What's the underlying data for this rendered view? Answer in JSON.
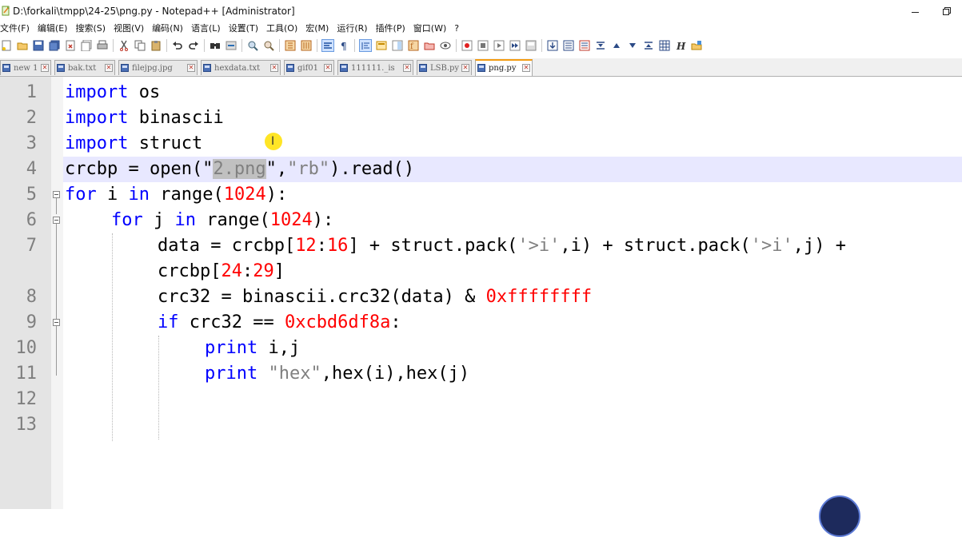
{
  "window": {
    "title": "D:\\forkali\\tmpp\\24-25\\png.py - Notepad++ [Administrator]"
  },
  "menu": [
    "文件(F)",
    "编辑(E)",
    "搜索(S)",
    "视图(V)",
    "编码(N)",
    "语言(L)",
    "设置(T)",
    "工具(O)",
    "宏(M)",
    "运行(R)",
    "插件(P)",
    "窗口(W)",
    "?"
  ],
  "toolbar_icons": [
    "new-file-icon",
    "open-file-icon",
    "save-icon",
    "save-all-icon",
    "close-icon",
    "close-all-icon",
    "print-icon",
    "cut-icon",
    "copy-icon",
    "paste-icon",
    "undo-icon",
    "redo-icon",
    "find-icon",
    "replace-icon",
    "zoom-in-icon",
    "zoom-out-icon",
    "sync-vertical-icon",
    "sync-horizontal-icon",
    "word-wrap-icon",
    "show-all-chars-icon",
    "indent-guide-icon",
    "user-language-icon",
    "doc-map-icon",
    "function-list-icon",
    "folder-workspace-icon",
    "monitoring-icon",
    "record-macro-icon",
    "stop-record-icon",
    "play-macro-icon",
    "play-multiple-icon",
    "save-macro-icon",
    "compare-icon",
    "compare-lines-icon",
    "compare-diff-icon",
    "navigate-first-icon",
    "navigate-prev-icon",
    "navigate-next-icon",
    "navigate-last-icon",
    "settings-grid-icon",
    "hex-h-icon",
    "plugin-folder-icon"
  ],
  "tabs": [
    {
      "label": "new 1",
      "active": false
    },
    {
      "label": "bak.txt",
      "active": false
    },
    {
      "label": "filejpg.jpg",
      "active": false
    },
    {
      "label": "hexdata.txt",
      "active": false
    },
    {
      "label": "gif01",
      "active": false
    },
    {
      "label": "111111._is",
      "active": false
    },
    {
      "label": "LSB.py",
      "active": false
    },
    {
      "label": "png.py",
      "active": true
    }
  ],
  "editor": {
    "line_numbers": [
      "1",
      "2",
      "3",
      "4",
      "5",
      "6",
      "7",
      "",
      "8",
      "9",
      "10",
      "11",
      "12",
      "13"
    ],
    "code": {
      "l1_kw": "import",
      "l1_rest": " os",
      "l2_kw": "import",
      "l2_rest": " binascii",
      "l3_kw": "import",
      "l3_rest": " struct",
      "l4_a": "crcbp = open(\"",
      "l4_sel": "2.png",
      "l4_b": "\",",
      "l4_str": "\"rb\"",
      "l4_c": ").read()",
      "l5_kw1": "for",
      "l5_a": " i ",
      "l5_kw2": "in",
      "l5_b": " range(",
      "l5_num": "1024",
      "l5_c": "):",
      "l6_kw1": "for",
      "l6_a": " j ",
      "l6_kw2": "in",
      "l6_b": " range(",
      "l6_num": "1024",
      "l6_c": "):",
      "l7_a": "data = crcbp[",
      "l7_n1": "12",
      "l7_b": ":",
      "l7_n2": "16",
      "l7_c": "] + struct.pack(",
      "l7_s1": "'>i'",
      "l7_d": ",i) + struct.pack(",
      "l7_s2": "'>i'",
      "l7_e": ",j) +",
      "l7w_a": "crcbp[",
      "l7w_n1": "24",
      "l7w_b": ":",
      "l7w_n2": "29",
      "l7w_c": "]",
      "l8_a": "crc32 = binascii.crc32(data) & ",
      "l8_num": "0xffffffff",
      "l9_kw": "if",
      "l9_a": " crc32 == ",
      "l9_num": "0xcbd6df8a",
      "l9_b": ":",
      "l10_kw": "print",
      "l10_a": " i,j",
      "l11_kw": "print",
      "l11_str": "\"hex\"",
      "l11_a": ",hex(i),hex(j)"
    }
  },
  "colors": {
    "keyword": "#0000ff",
    "number": "#ff0000",
    "string": "#808080",
    "current_line": "#e8e8ff",
    "selection": "#c0c0c0",
    "active_tab_accent": "#f39c12"
  },
  "cursor": "I-beam",
  "overlay": {
    "icon": "play-button-watermark-icon"
  }
}
